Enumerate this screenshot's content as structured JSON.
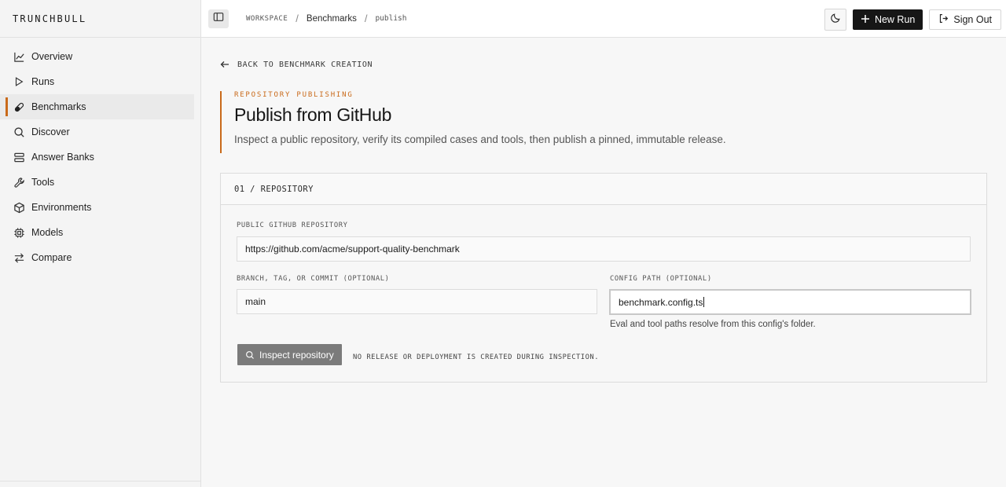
{
  "brand": {
    "name": "TRUNCHBULL"
  },
  "sidebar": {
    "items": [
      {
        "label": "Overview",
        "icon": "chart-line-icon"
      },
      {
        "label": "Runs",
        "icon": "play-icon"
      },
      {
        "label": "Benchmarks",
        "icon": "pill-icon",
        "active": true
      },
      {
        "label": "Discover",
        "icon": "search-icon"
      },
      {
        "label": "Answer Banks",
        "icon": "stack-icon"
      },
      {
        "label": "Tools",
        "icon": "wrench-icon"
      },
      {
        "label": "Environments",
        "icon": "cube-icon"
      },
      {
        "label": "Models",
        "icon": "chip-icon"
      },
      {
        "label": "Compare",
        "icon": "arrows-left-right-icon"
      }
    ]
  },
  "topbar": {
    "breadcrumb": {
      "workspace": "WORKSPACE",
      "section": "Benchmarks",
      "current": "publish"
    },
    "new_run_label": "New Run",
    "sign_out_label": "Sign Out"
  },
  "main": {
    "back_label": "BACK TO BENCHMARK CREATION",
    "eyebrow": "REPOSITORY PUBLISHING",
    "title": "Publish from GitHub",
    "subtitle": "Inspect a public repository, verify its compiled cases and tools, then publish a pinned, immutable release.",
    "card": {
      "heading": "01 / REPOSITORY",
      "repo_label": "PUBLIC GITHUB REPOSITORY",
      "repo_value": "https://github.com/acme/support-quality-benchmark",
      "ref_label": "BRANCH, TAG, OR COMMIT (OPTIONAL)",
      "ref_value": "main",
      "config_label": "CONFIG PATH (OPTIONAL)",
      "config_value": "benchmark.config.ts",
      "config_helper": "Eval and tool paths resolve from this config's folder.",
      "inspect_label": "Inspect repository",
      "note": "NO RELEASE OR DEPLOYMENT IS CREATED DURING INSPECTION."
    }
  },
  "colors": {
    "accent": "#c96a1a",
    "dark_button": "#161616",
    "disabled_button": "#7b7b7b"
  }
}
